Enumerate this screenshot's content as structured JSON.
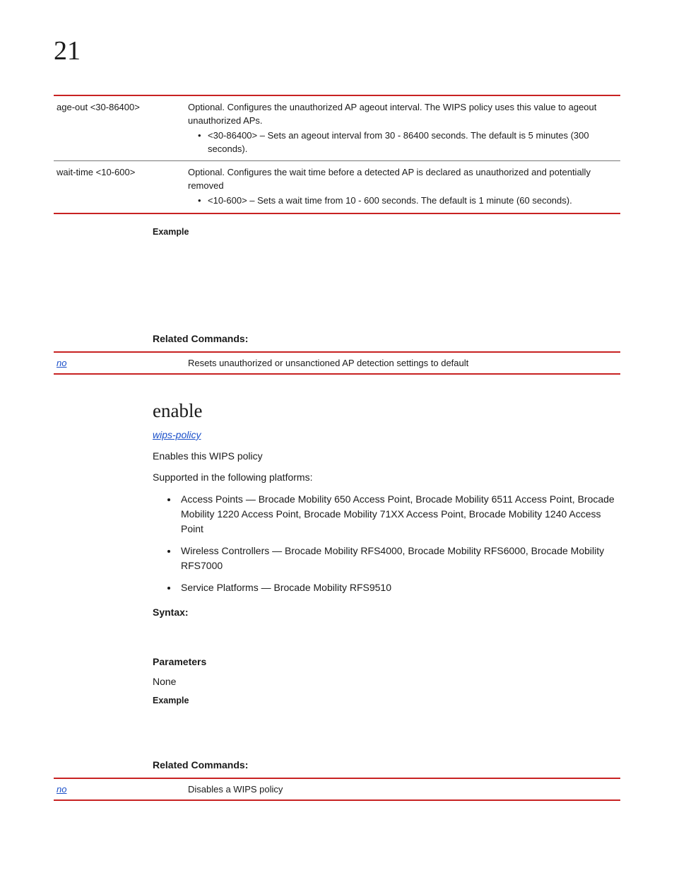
{
  "chapterNumber": "21",
  "paramTable": [
    {
      "param": "age-out <30-86400>",
      "desc": "Optional. Configures the unauthorized AP ageout interval. The WIPS policy uses this value to ageout unauthorized APs.",
      "bullet": "<30-86400> – Sets an ageout interval from 30 - 86400 seconds. The default is 5 minutes (300 seconds)."
    },
    {
      "param": "wait-time <10-600>",
      "desc": "Optional. Configures the wait time before a detected AP is declared as unauthorized and potentially removed",
      "bullet": "<10-600> – Sets a wait time from 10 - 600 seconds. The default is 1 minute (60 seconds)."
    }
  ],
  "labels": {
    "example": "Example",
    "relatedCommands": "Related Commands:",
    "syntax": "Syntax:",
    "parameters": "Parameters"
  },
  "related1": {
    "cmd": "no",
    "desc": "Resets unauthorized or unsanctioned AP detection settings to default"
  },
  "enable": {
    "title": "enable",
    "breadcrumb": "wips-policy",
    "intro": "Enables this WIPS policy",
    "supported": "Supported in the following platforms:",
    "platforms": [
      "Access Points — Brocade Mobility 650 Access Point, Brocade Mobility 6511 Access Point, Brocade Mobility 1220 Access Point, Brocade Mobility 71XX Access Point, Brocade Mobility 1240 Access Point",
      "Wireless Controllers — Brocade Mobility RFS4000, Brocade Mobility RFS6000, Brocade Mobility RFS7000",
      "Service Platforms — Brocade Mobility RFS9510"
    ],
    "paramsNone": "None"
  },
  "related2": {
    "cmd": "no",
    "desc": "Disables a WIPS policy"
  }
}
